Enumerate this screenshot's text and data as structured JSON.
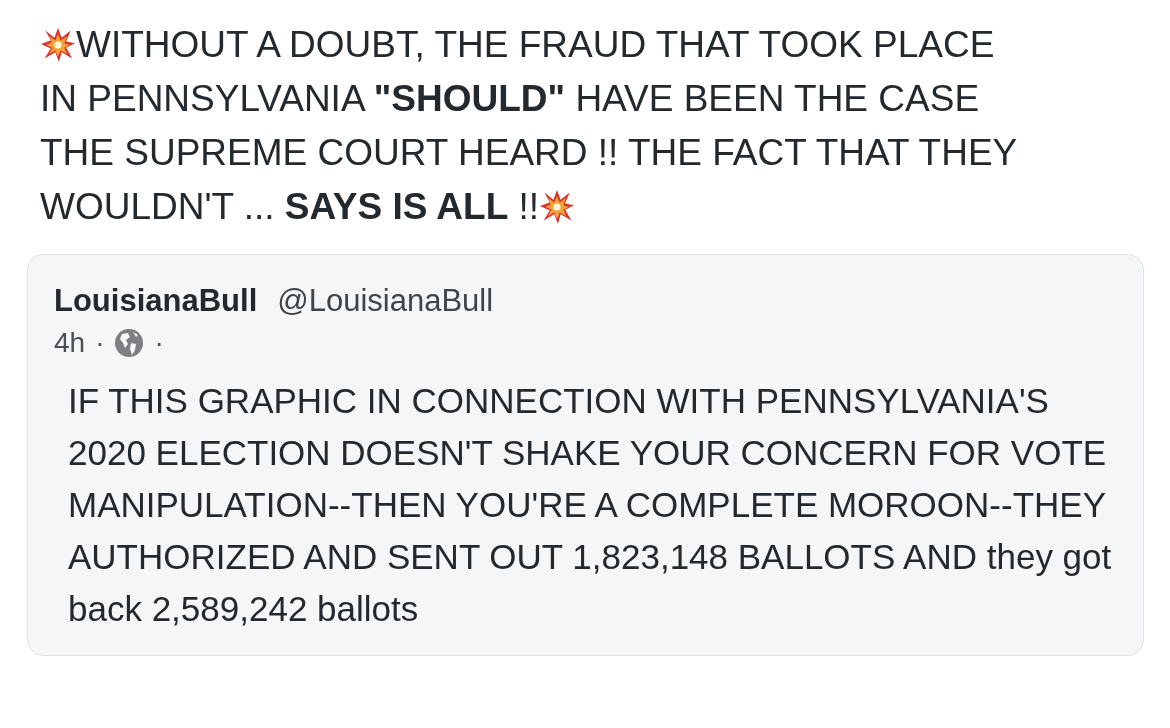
{
  "post": {
    "lines": [
      "WITHOUT A DOUBT, THE FRAUD THAT TOOK PLACE",
      "IN PENNSYLVANIA **\"SHOULD\"** HAVE BEEN THE CASE",
      "THE SUPREME COURT HEARD !! THE FACT THAT THEY",
      "WOULDN'T ... **SAYS IS ALL** !!"
    ]
  },
  "quoted_post": {
    "display_name": "LouisianaBull",
    "handle": "@LouisianaBull",
    "time": "4h",
    "separator_1": "·",
    "separator_2": "·",
    "text": "IF THIS GRAPHIC IN CONNECTION WITH PENNSYLVANIA'S 2020 ELECTION DOESN'T SHAKE YOUR CONCERN FOR VOTE MANIPULATION--THEN YOU'RE A COMPLETE MOROON--THEY AUTHORIZED AND SENT OUT 1,823,148 BALLOTS AND they got back 2,589,242 ballots"
  }
}
